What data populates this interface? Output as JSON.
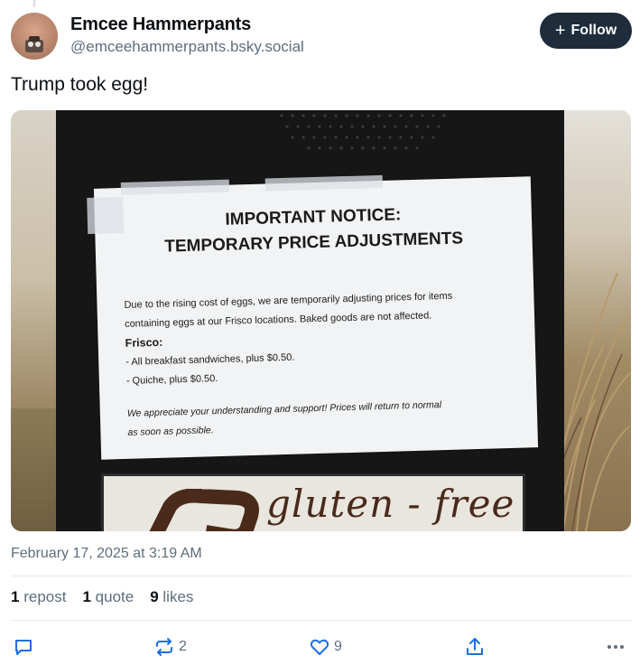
{
  "author": {
    "display_name": "Emcee Hammerpants",
    "handle": "@emceehammerpants.bsky.social"
  },
  "follow_button": {
    "icon": "plus-icon",
    "label": "Follow"
  },
  "post": {
    "text": "Trump took egg!",
    "timestamp": "February 17, 2025 at 3:19 AM"
  },
  "image": {
    "notice": {
      "title_line1": "IMPORTANT NOTICE:",
      "title_line2": "TEMPORARY PRICE ADJUSTMENTS",
      "body_line1": "Due to the rising cost of eggs, we are temporarily adjusting prices for items",
      "body_line2": "containing eggs at our Frisco locations. Baked goods are not affected.",
      "location": "Frisco:",
      "item1": "- All breakfast sandwiches, plus $0.50.",
      "item2": "- Quiche, plus $0.50.",
      "footer_line1": "We appreciate your understanding and support! Prices will return to normal",
      "footer_line2": "as soon as possible."
    },
    "bottom_sign_text": "gluten - free"
  },
  "stats": {
    "reposts_count": "1",
    "reposts_label": "repost",
    "quotes_count": "1",
    "quotes_label": "quote",
    "likes_count": "9",
    "likes_label": "likes"
  },
  "actions": {
    "reply_icon": "reply-icon",
    "repost_icon": "repost-icon",
    "repost_count": "2",
    "like_icon": "heart-icon",
    "like_count": "9",
    "share_icon": "share-icon",
    "more_icon": "more-icon"
  },
  "colors": {
    "follow_button_bg": "#1e2c3c",
    "secondary_text": "#5e6e7e",
    "primary_text": "#0b0f14",
    "divider": "#e3e8ee"
  }
}
